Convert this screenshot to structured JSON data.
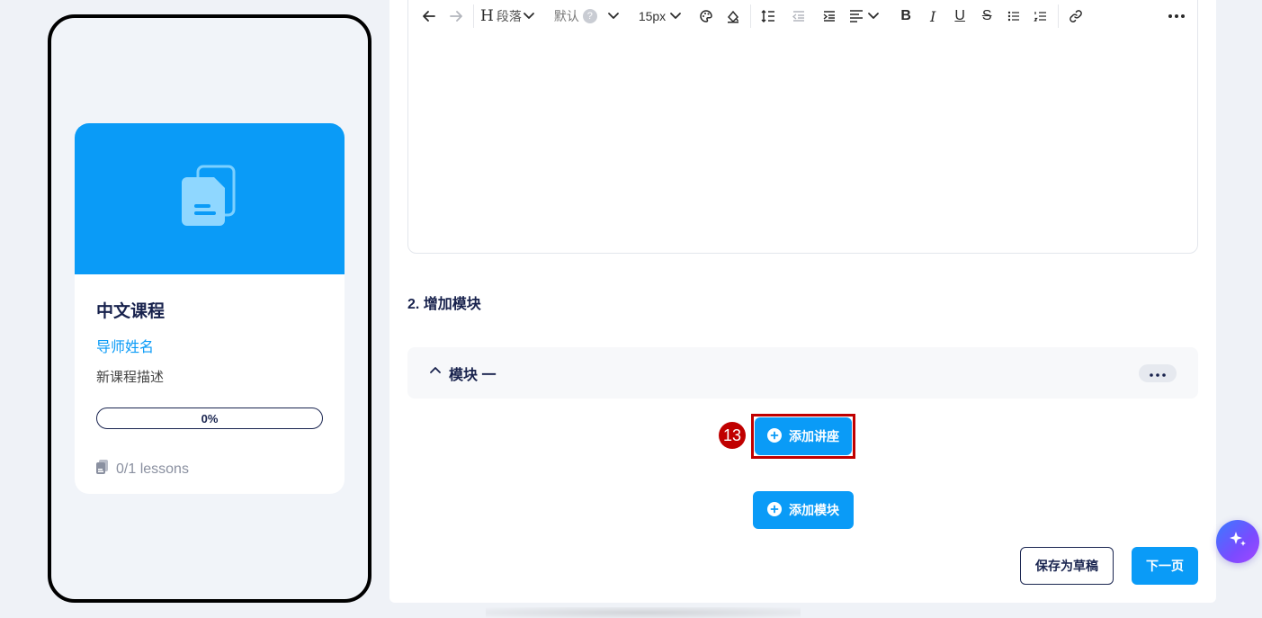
{
  "preview": {
    "course_title": "中文课程",
    "teacher_name": "导师姓名",
    "description": "新课程描述",
    "progress_label": "0%",
    "progress_value": 0,
    "lessons_label": "0/1 lessons"
  },
  "toolbar": {
    "heading_label": "段落",
    "font_label": "默认",
    "help_mark": "?",
    "size_label": "15px",
    "bold": "B",
    "italic": "I",
    "underline": "U",
    "strike": "S"
  },
  "section": {
    "title": "2. 增加模块"
  },
  "module": {
    "name": "模块 一"
  },
  "actions": {
    "add_lecture": "添加讲座",
    "add_module": "添加模块",
    "save_draft": "保存为草稿",
    "next_page": "下一页"
  },
  "annotation": {
    "step_number": "13"
  },
  "colors": {
    "primary": "#0a9bf7",
    "navy": "#1a2550",
    "highlight": "#c00000"
  }
}
